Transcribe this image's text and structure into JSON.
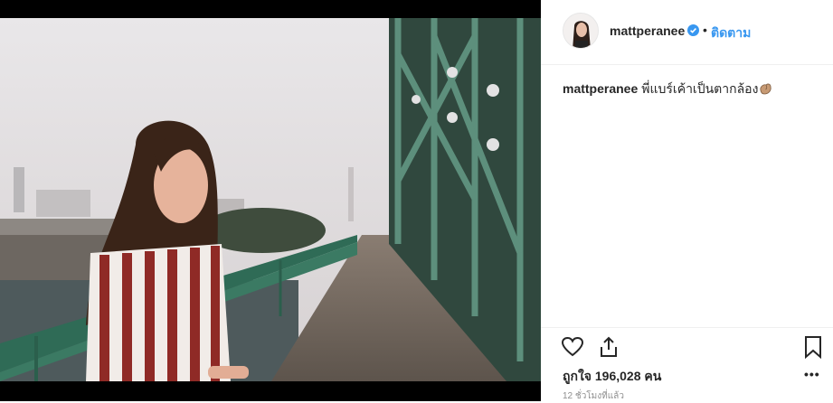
{
  "post": {
    "username": "mattperanee",
    "follow_label": "ติดตาม",
    "separator": "•",
    "caption_user": "mattperanee",
    "caption_text": "พี่แบร์เค้าเป็นตากล้อง",
    "caption_emoji": "flexed-biceps-icon",
    "likes_text": "ถูกใจ 196,028 คน",
    "more_label": "•••",
    "time_text": "12 ชั่วโมงที่แล้ว"
  },
  "icons": {
    "like": "heart-icon",
    "share": "share-icon",
    "save": "bookmark-icon",
    "verified": "verified-badge-icon"
  },
  "colors": {
    "link_blue": "#3897f0",
    "text": "#262626",
    "muted": "#8e8e8e",
    "bridge_green": "#2f6b56"
  }
}
